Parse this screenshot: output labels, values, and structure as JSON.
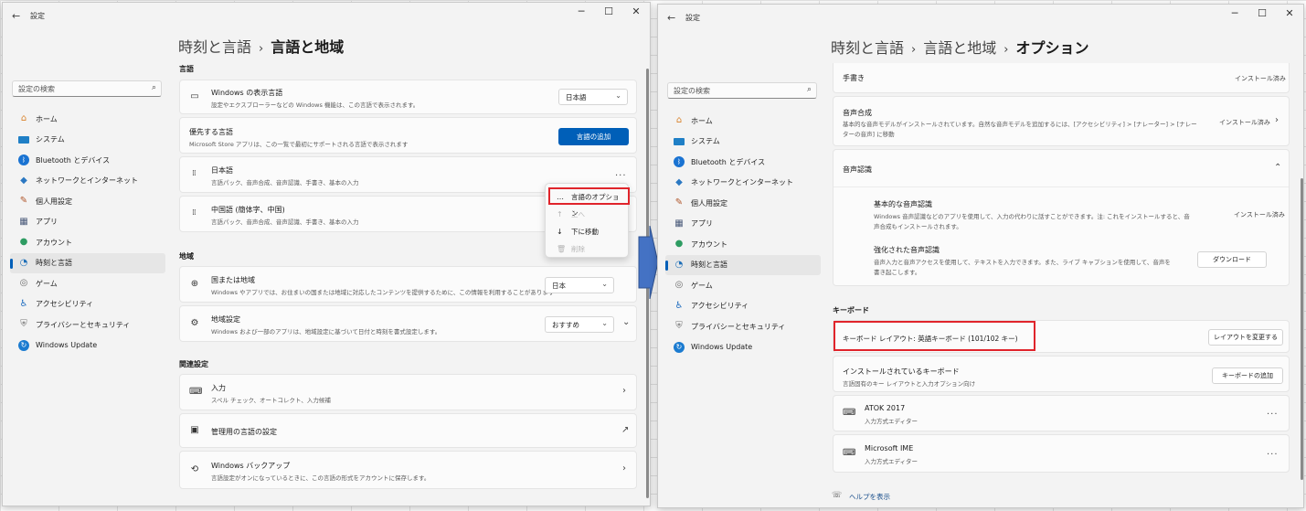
{
  "left": {
    "app_title": "設定",
    "search_placeholder": "設定の検索",
    "breadcrumb": {
      "parent": "時刻と言語",
      "current": "言語と地域"
    },
    "nav": [
      {
        "label": "ホーム",
        "icon": "home-icon"
      },
      {
        "label": "システム",
        "icon": "system-icon"
      },
      {
        "label": "Bluetooth とデバイス",
        "icon": "bluetooth-icon"
      },
      {
        "label": "ネットワークとインターネット",
        "icon": "network-icon"
      },
      {
        "label": "個人用設定",
        "icon": "personalization-icon"
      },
      {
        "label": "アプリ",
        "icon": "apps-icon"
      },
      {
        "label": "アカウント",
        "icon": "account-icon"
      },
      {
        "label": "時刻と言語",
        "icon": "time-language-icon",
        "active": true
      },
      {
        "label": "ゲーム",
        "icon": "game-icon"
      },
      {
        "label": "アクセシビリティ",
        "icon": "accessibility-icon"
      },
      {
        "label": "プライバシーとセキュリティ",
        "icon": "privacy-icon"
      },
      {
        "label": "Windows Update",
        "icon": "windows-update-icon"
      }
    ],
    "sections": {
      "language": "言語",
      "region": "地域",
      "related": "関連設定"
    },
    "display_language": {
      "title": "Windows の表示言語",
      "desc": "設定やエクスプローラーなどの Windows 機能は、この言語で表示されます。",
      "value": "日本語"
    },
    "preferred": {
      "title": "優先する言語",
      "desc": "Microsoft Store アプリは、この一覧で最初にサポートされる言語で表示されます",
      "button": "言語の追加"
    },
    "lang_japanese": {
      "title": "日本語",
      "desc": "言語パック、音声合成、音声認識、手書き、基本の入力",
      "more": "..."
    },
    "lang_chinese": {
      "title": "中国語 (簡体字、中国)",
      "desc": "言語パック、音声合成、音声認識、手書き、基本の入力"
    },
    "context_menu": {
      "options": "言語のオプション",
      "up": "上へ",
      "down": "下に移動",
      "remove": "削除"
    },
    "country": {
      "title": "国または地域",
      "desc": "Windows やアプリでは、お住まいの国または地域に対応したコンテンツを提供するために、この情報を利用することがあります",
      "value": "日本"
    },
    "regional_format": {
      "title": "地域設定",
      "desc": "Windows および一部のアプリは、地域設定に基づいて日付と時刻を書式設定します。",
      "value": "おすすめ"
    },
    "input": {
      "title": "入力",
      "desc": "スペル チェック、オートコレクト、入力候補"
    },
    "admin_lang": {
      "title": "管理用の言語の設定"
    },
    "backup": {
      "title": "Windows バックアップ",
      "desc": "言語設定がオンになっているときに、この言語の形式をアカウントに保存します。"
    }
  },
  "right": {
    "app_title": "設定",
    "search_placeholder": "設定の検索",
    "breadcrumb": {
      "root": "時刻と言語",
      "parent": "言語と地域",
      "current": "オプション"
    },
    "nav": [
      {
        "label": "ホーム",
        "icon": "home-icon"
      },
      {
        "label": "システム",
        "icon": "system-icon"
      },
      {
        "label": "Bluetooth とデバイス",
        "icon": "bluetooth-icon"
      },
      {
        "label": "ネットワークとインターネット",
        "icon": "network-icon"
      },
      {
        "label": "個人用設定",
        "icon": "personalization-icon"
      },
      {
        "label": "アプリ",
        "icon": "apps-icon"
      },
      {
        "label": "アカウント",
        "icon": "account-icon"
      },
      {
        "label": "時刻と言語",
        "icon": "time-language-icon",
        "active": true
      },
      {
        "label": "ゲーム",
        "icon": "game-icon"
      },
      {
        "label": "アクセシビリティ",
        "icon": "accessibility-icon"
      },
      {
        "label": "プライバシーとセキュリティ",
        "icon": "privacy-icon"
      },
      {
        "label": "Windows Update",
        "icon": "windows-update-icon"
      }
    ],
    "handwriting": {
      "title": "手書き",
      "status": "インストール済み"
    },
    "tts": {
      "title": "音声合成",
      "desc1": "基本的な音声モデルがインストールされています。自然な音声モデルを追加するには、[アクセシビリティ] > [ナレーター] > [ナレー",
      "desc2": "ターの音声] に移動",
      "status": "インストール済み"
    },
    "speech": {
      "title": "音声認識",
      "basic_title": "基本的な音声認識",
      "basic_desc1": "Windows 音声認識などのアプリを使用して、入力の代わりに話すことができます。注: これをインストールすると、音",
      "basic_desc2": "声合成もインストールされます。",
      "basic_status": "インストール済み",
      "enh_title": "強化された音声認識",
      "enh_desc1": "音声入力と音声アクセスを使用して、テキストを入力できます。また、ライブ キャプションを使用して、音声を",
      "enh_desc2": "書き起こします。",
      "enh_button": "ダウンロード"
    },
    "keyboard_section": "キーボード",
    "keyboard_layout": {
      "title": "キーボード レイアウト: 英語キーボード (101/102 キー)",
      "button": "レイアウトを変更する"
    },
    "installed_kb": {
      "title": "インストールされているキーボード",
      "desc": "言語固有のキー レイアウトと入力オプション向け",
      "button": "キーボードの追加"
    },
    "atok": {
      "title": "ATOK 2017",
      "desc": "入力方式エディター",
      "more": "..."
    },
    "msime": {
      "title": "Microsoft IME",
      "desc": "入力方式エディター",
      "more": "..."
    },
    "help": "ヘルプを表示"
  },
  "colors": {
    "accent": "#005fb8",
    "highlight_red": "#e0242b",
    "arrow_blue": "#4472c4"
  }
}
